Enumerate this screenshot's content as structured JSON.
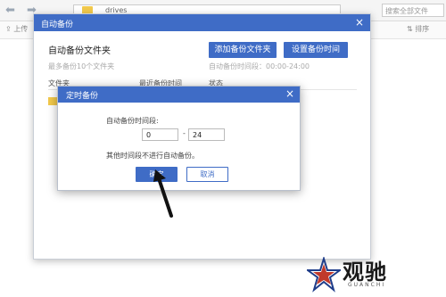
{
  "file_manager": {
    "path": "drives",
    "search_placeholder": "搜索全部文件",
    "upload_label": "上传",
    "sort_label": "排序"
  },
  "auto_backup_dialog": {
    "title": "自动备份",
    "close": "×",
    "section_title": "自动备份文件夹",
    "hint": "最多备份10个文件夹",
    "add_folder_button": "添加备份文件夹",
    "set_time_button": "设置备份时间",
    "time_range": "自动备份时间段：00:00-24:00",
    "columns": [
      "文件夹",
      "最近备份时间",
      "状态"
    ]
  },
  "timer_dialog": {
    "title": "定时备份",
    "close": "×",
    "period_label": "自动备份时间段:",
    "start_value": "0",
    "dash": "-",
    "end_value": "24",
    "note": "其他时间段不进行自动备份。",
    "confirm_button": "确定",
    "cancel_button": "取消"
  },
  "watermark": {
    "brand": "观驰",
    "sub": "GUANCHI"
  },
  "colors": {
    "accent": "#3f6cc6",
    "folder": "#f2c94c"
  }
}
